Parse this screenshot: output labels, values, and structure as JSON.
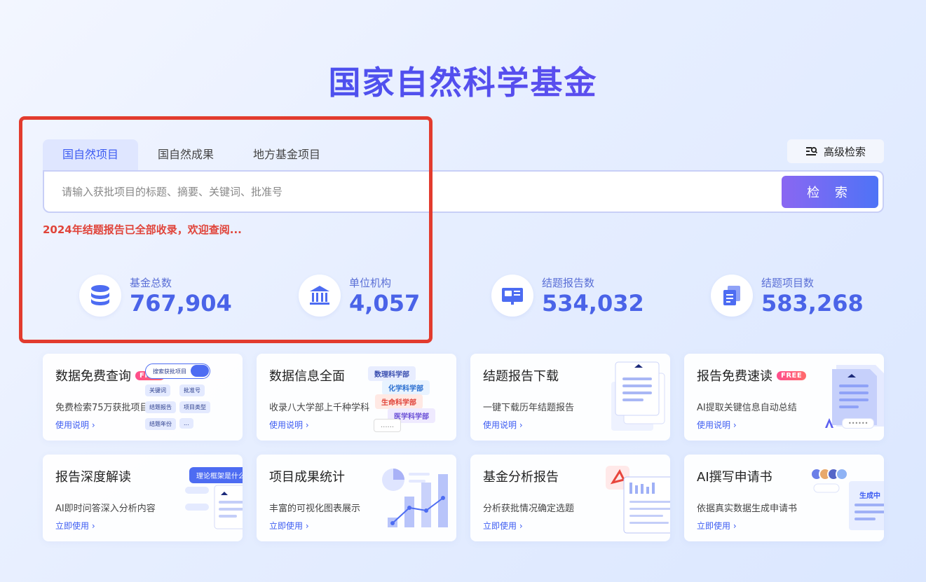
{
  "page": {
    "title": "国家自然科学基金"
  },
  "tabs": [
    {
      "label": "国自然项目",
      "active": true
    },
    {
      "label": "国自然成果",
      "active": false
    },
    {
      "label": "地方基金项目",
      "active": false
    }
  ],
  "advanced_search": {
    "label": "高级检索"
  },
  "search": {
    "placeholder": "请输入获批项目的标题、摘要、关键词、批准号",
    "button_label": "检 索"
  },
  "notice": "2024年结题报告已全部收录，欢迎查阅...",
  "stats": [
    {
      "label": "基金总数",
      "value": "767,904",
      "icon": "database-icon"
    },
    {
      "label": "单位机构",
      "value": "4,057",
      "icon": "institution-icon"
    },
    {
      "label": "结题报告数",
      "value": "534,032",
      "icon": "report-icon"
    },
    {
      "label": "结题项目数",
      "value": "583,268",
      "icon": "documents-icon"
    }
  ],
  "cards": [
    {
      "title": "数据免费查询",
      "badge": "FREE",
      "desc": "免费检索75万获批项目",
      "link": "使用说明",
      "art": {
        "search_box": "搜索获批项目",
        "chips": [
          "关键词",
          "批准号",
          "结题报告",
          "项目类型",
          "结题年份",
          "..."
        ]
      }
    },
    {
      "title": "数据信息全面",
      "badge": "",
      "desc": "收录八大学部上千种学科",
      "link": "使用说明",
      "art": {
        "tags": [
          "数理科学部",
          "化学科学部",
          "生命科学部",
          "医学科学部"
        ],
        "dots": "......"
      }
    },
    {
      "title": "结题报告下载",
      "badge": "",
      "desc": "一键下载历年结题报告",
      "link": "使用说明",
      "art": {}
    },
    {
      "title": "报告免费速读",
      "badge": "FREE",
      "desc": "AI提取关键信息自动总结",
      "link": "使用说明",
      "art": {
        "dots": "••••••"
      }
    },
    {
      "title": "报告深度解读",
      "badge": "",
      "desc": "AI即时问答深入分析内容",
      "link": "立即使用",
      "art": {
        "bubble": "理论框架是什么?"
      }
    },
    {
      "title": "项目成果统计",
      "badge": "",
      "desc": "丰富的可视化图表展示",
      "link": "立即使用",
      "art": {}
    },
    {
      "title": "基金分析报告",
      "badge": "",
      "desc": "分析获批情况确定选题",
      "link": "立即使用",
      "art": {}
    },
    {
      "title": "AI撰写申请书",
      "badge": "",
      "desc": "依据真实数据生成申请书",
      "link": "立即使用",
      "art": {
        "status": "生成中"
      }
    }
  ],
  "colors": {
    "accent": "#3d5cf2",
    "notice": "#e0443a",
    "highlight": "#e23b2e"
  }
}
